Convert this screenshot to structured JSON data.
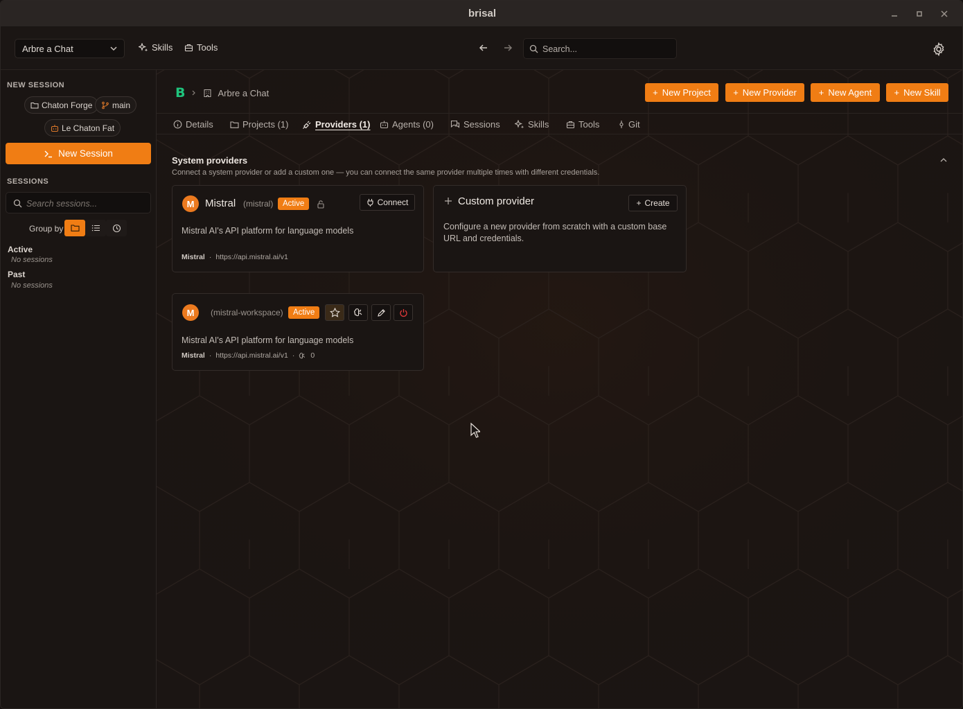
{
  "window": {
    "title": "brisal"
  },
  "topbar": {
    "project": "Arbre a Chat",
    "nav_skills": "Skills",
    "nav_tools": "Tools",
    "search_placeholder": "Search..."
  },
  "sidebar": {
    "new_session_heading": "NEW SESSION",
    "chips": {
      "project": "Chaton Forge",
      "branch": "main",
      "agent": "Le Chaton Fat"
    },
    "new_session_button": "New Session",
    "sessions_heading": "SESSIONS",
    "search_placeholder": "Search sessions...",
    "group_by_label": "Group by",
    "groups": [
      {
        "name": "Active",
        "empty": "No sessions"
      },
      {
        "name": "Past",
        "empty": "No sessions"
      }
    ]
  },
  "main": {
    "breadcrumb": {
      "logo": "B",
      "project": "Arbre a Chat"
    },
    "actions": {
      "new_project": "New Project",
      "new_provider": "New Provider",
      "new_agent": "New Agent",
      "new_skill": "New Skill"
    },
    "tabs": [
      {
        "label": "Details"
      },
      {
        "label": "Projects (1)"
      },
      {
        "label": "Providers (1)"
      },
      {
        "label": "Agents (0)"
      },
      {
        "label": "Sessions"
      },
      {
        "label": "Skills"
      },
      {
        "label": "Tools"
      },
      {
        "label": "Git"
      }
    ],
    "section_title": "System providers",
    "section_subtitle": "Connect a system provider or add a custom one — you can connect the same provider multiple times with different credentials.",
    "system_card": {
      "avatar": "M",
      "name": "Mistral",
      "id": "(mistral)",
      "status": "Active",
      "connect": "Connect",
      "description": "Mistral AI's API platform for language models",
      "vendor": "Mistral",
      "url": "https://api.mistral.ai/v1"
    },
    "custom_card": {
      "title": "Custom provider",
      "create": "Create",
      "description": "Configure a new provider from scratch with a custom base URL and credentials."
    },
    "connected_card": {
      "avatar": "M",
      "id": "(mistral-workspace)",
      "status": "Active",
      "description": "Mistral AI's API platform for language models",
      "vendor": "Mistral",
      "url": "https://api.mistral.ai/v1",
      "skill_count": "0"
    }
  },
  "colors": {
    "accent": "#f07d14",
    "logo": "#1fc47d",
    "danger": "#e0383a"
  }
}
